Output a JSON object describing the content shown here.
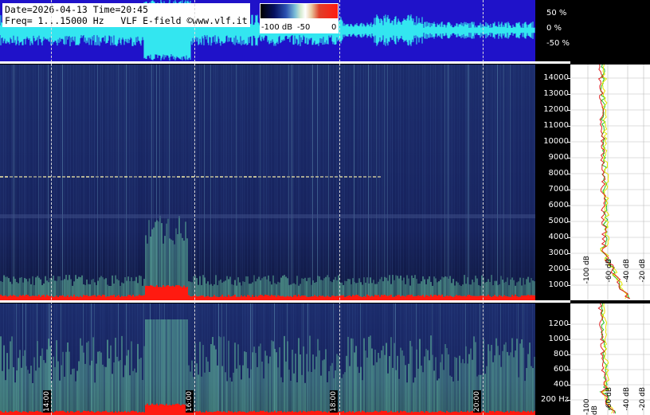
{
  "info": {
    "line1": "Date=2026-04-13 Time=20:45",
    "line2": "Freq= 1...15000 Hz   VLF E-field ©www.vlf.it"
  },
  "color_scale": {
    "labels": [
      "-100 dB",
      "-50",
      "0"
    ]
  },
  "waveform_axis": [
    "50 %",
    "0 %",
    "-50 %"
  ],
  "spectrogram_axis": [
    "14000",
    "13000",
    "12000",
    "11000",
    "10000",
    "9000",
    "8000",
    "7000",
    "6000",
    "5000",
    "4000",
    "3000",
    "2000",
    "1000"
  ],
  "lower_axis": [
    "1200",
    "1000",
    "800",
    "600",
    "400",
    "200 Hz"
  ],
  "time_labels": [
    "14:00",
    "16:00",
    "18:00",
    "20:00"
  ],
  "profile_db_labels": [
    "-100 dB",
    "-60 dB",
    "-40 dB",
    "-20 dB"
  ],
  "colors": {
    "waveform_bg": "#1f12c9",
    "waveform_signal": "#33e6f0",
    "spectrogram_bg": "#14205a",
    "hot": "#ff1a10",
    "profile_red": "#e02020",
    "profile_yellow": "#e6e600",
    "profile_green": "#20c020"
  }
}
